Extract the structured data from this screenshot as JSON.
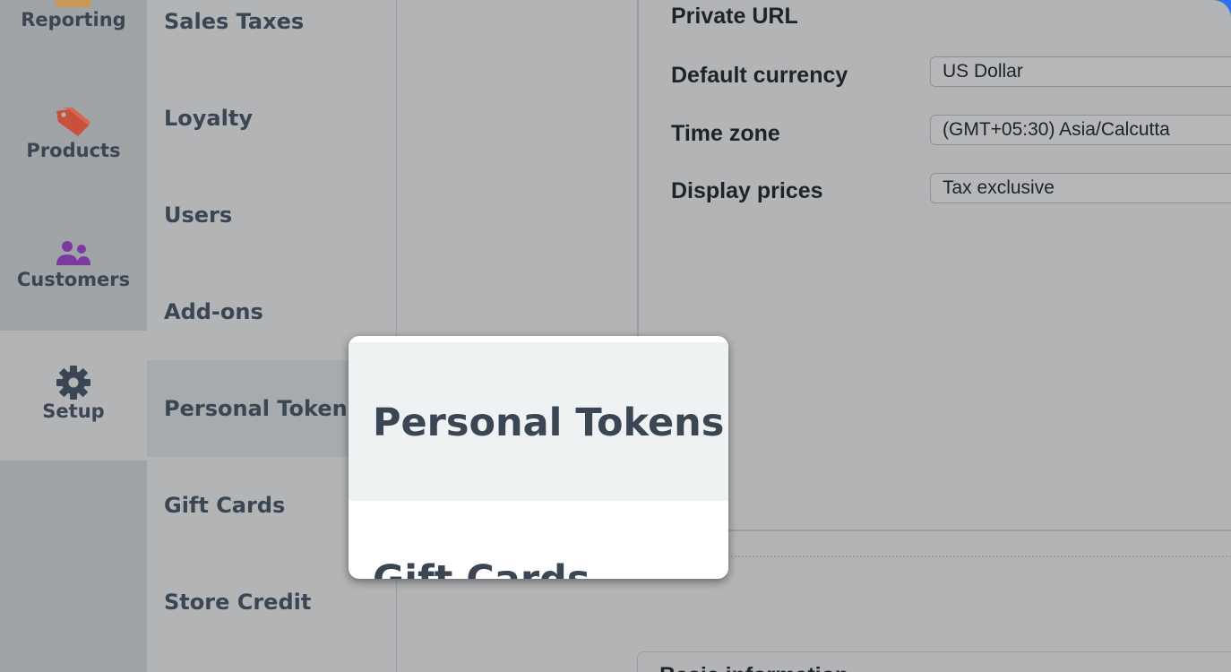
{
  "rail": {
    "items": [
      {
        "label": "Reporting",
        "icon": "reporting-icon"
      },
      {
        "label": "Products",
        "icon": "tag-icon",
        "icon_color": "#c8513c"
      },
      {
        "label": "Customers",
        "icon": "users-icon",
        "icon_color": "#7b3aa0"
      },
      {
        "label": "Setup",
        "icon": "gear-icon",
        "active": true
      }
    ]
  },
  "submenu": {
    "items": [
      {
        "label": "Sales Taxes"
      },
      {
        "label": "Loyalty"
      },
      {
        "label": "Users"
      },
      {
        "label": "Add-ons"
      },
      {
        "label": "Personal Tokens",
        "active": true
      },
      {
        "label": "Gift Cards"
      },
      {
        "label": "Store Credit"
      }
    ]
  },
  "settings": {
    "private_url_label": "Private URL",
    "default_currency_label": "Default currency",
    "default_currency_value": "US Dollar",
    "time_zone_label": "Time zone",
    "time_zone_value": "(GMT+05:30) Asia/Calcutta",
    "display_prices_label": "Display prices",
    "display_prices_value": "Tax exclusive",
    "next_section_label": "Basic information"
  },
  "popup": {
    "title": "Personal Tokens",
    "next_item": "Gift Cards"
  },
  "colors": {
    "accent_window": "#2f6ff0",
    "text_dark": "#3a4653"
  }
}
